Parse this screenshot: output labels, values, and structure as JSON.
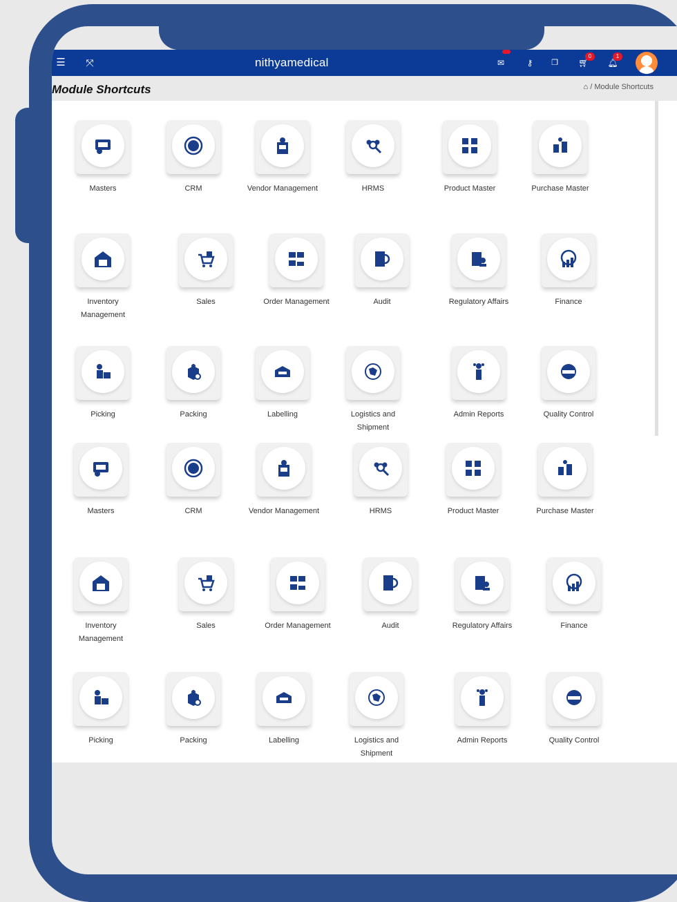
{
  "app": {
    "brand": "nithyamedical",
    "badges": {
      "cart": "0",
      "bell": "1"
    }
  },
  "page": {
    "title": "Module Shortcuts",
    "breadcrumb": {
      "separator": "/",
      "current": "Module Shortcuts"
    }
  },
  "colors": {
    "frame": "#2d4f8b",
    "navbar": "#0c3a97",
    "icon": "#1a3d8a",
    "badge": "#e2182d"
  },
  "sections": [
    {
      "rows": [
        [
          {
            "label": "Masters",
            "icon": "certificate-icon"
          },
          {
            "label": "CRM",
            "icon": "crm-icon"
          },
          {
            "label": "Vendor Management",
            "icon": "vendor-icon"
          },
          {
            "label": "HRMS",
            "icon": "team-search-icon"
          },
          {
            "label": "Product Master",
            "icon": "product-boxes-icon"
          },
          {
            "label": "Purchase Master",
            "icon": "purchase-icon"
          }
        ],
        [
          {
            "label": "Inventory Management",
            "icon": "warehouse-icon"
          },
          {
            "label": "Sales",
            "icon": "cart-tag-icon"
          },
          {
            "label": "Order Management",
            "icon": "order-icon"
          },
          {
            "label": "Audit",
            "icon": "audit-icon"
          },
          {
            "label": "Regulatory Affairs",
            "icon": "regulatory-icon"
          },
          {
            "label": "Finance",
            "icon": "finance-globe-icon"
          }
        ],
        [
          {
            "label": "Picking",
            "icon": "picking-icon"
          },
          {
            "label": "Packing",
            "icon": "packing-icon"
          },
          {
            "label": "Labelling",
            "icon": "label-tag-icon"
          },
          {
            "label": "Logistics and Shipment",
            "icon": "logistics-globe-icon"
          },
          {
            "label": "Admin Reports",
            "icon": "admin-reports-icon"
          },
          {
            "label": "Quality Control",
            "icon": "qc-stamp-icon"
          }
        ]
      ]
    },
    {
      "rows": [
        [
          {
            "label": "Masters",
            "icon": "certificate-icon"
          },
          {
            "label": "CRM",
            "icon": "crm-icon"
          },
          {
            "label": "Vendor Management",
            "icon": "vendor-icon"
          },
          {
            "label": "HRMS",
            "icon": "team-search-icon"
          },
          {
            "label": "Product Master",
            "icon": "product-boxes-icon"
          },
          {
            "label": "Purchase Master",
            "icon": "purchase-icon"
          }
        ],
        [
          {
            "label": "Inventory Management",
            "icon": "warehouse-icon"
          },
          {
            "label": "Sales",
            "icon": "cart-tag-icon"
          },
          {
            "label": "Order Management",
            "icon": "order-icon"
          },
          {
            "label": "Audit",
            "icon": "audit-icon"
          },
          {
            "label": "Regulatory Affairs",
            "icon": "regulatory-icon"
          },
          {
            "label": "Finance",
            "icon": "finance-globe-icon"
          }
        ],
        [
          {
            "label": "Picking",
            "icon": "picking-icon"
          },
          {
            "label": "Packing",
            "icon": "packing-icon"
          },
          {
            "label": "Labelling",
            "icon": "label-tag-icon"
          },
          {
            "label": "Logistics and Shipment",
            "icon": "logistics-globe-icon"
          },
          {
            "label": "Admin Reports",
            "icon": "admin-reports-icon"
          },
          {
            "label": "Quality Control",
            "icon": "qc-stamp-icon"
          }
        ]
      ]
    }
  ]
}
